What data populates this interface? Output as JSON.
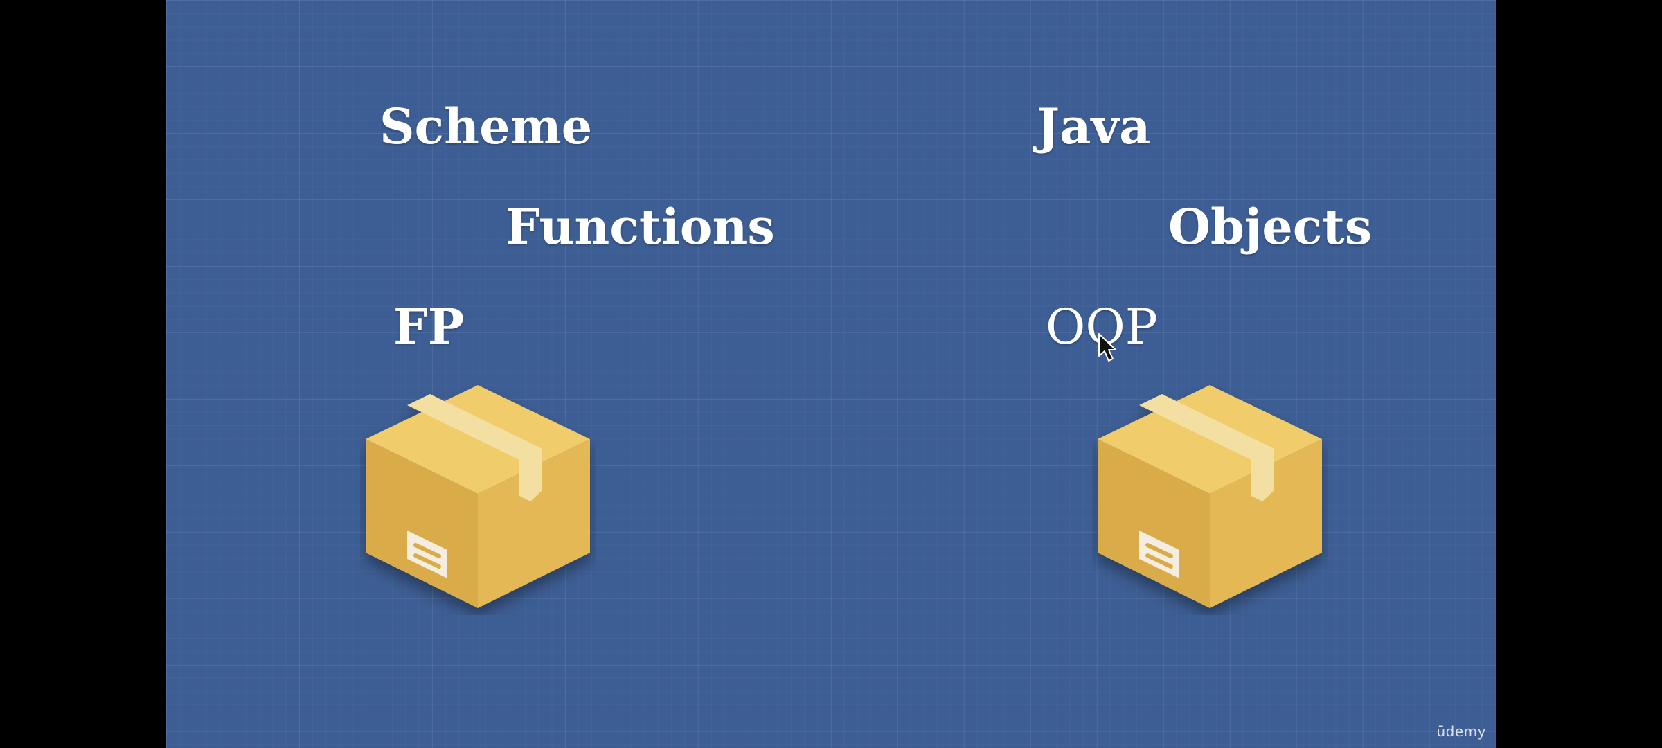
{
  "slide": {
    "left_column": {
      "language": "Scheme",
      "concept": "Functions",
      "paradigm": "FP"
    },
    "right_column": {
      "language": "Java",
      "concept": "Objects",
      "paradigm": "OOP"
    },
    "watermark": "ūdemy"
  },
  "colors": {
    "background": "#3d5e94",
    "frame": "#000000",
    "text": "#ffffff",
    "box_top": "#f0cc6a",
    "box_left": "#d9ac4a",
    "box_right": "#e4b955",
    "box_tape": "#f4dfa3",
    "box_label": "#f5eee0"
  },
  "icons": {
    "box": "cardboard-box-icon",
    "cursor": "mouse-pointer-icon"
  }
}
